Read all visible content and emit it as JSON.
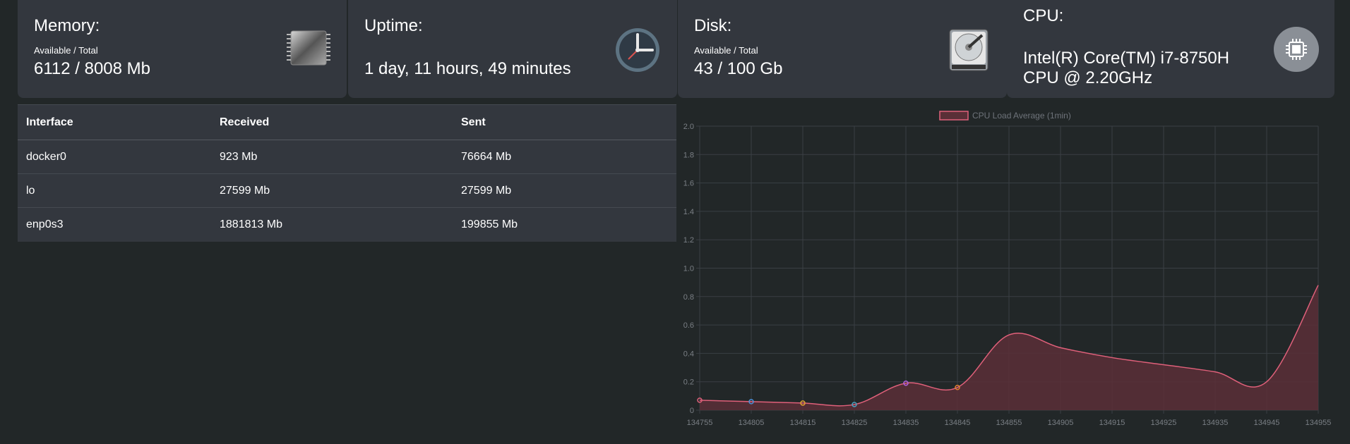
{
  "memory": {
    "title": "Memory:",
    "sub": "Available / Total",
    "value": "6112 / 8008 Mb",
    "icon": "memory-chip-icon"
  },
  "uptime": {
    "title": "Uptime:",
    "value": "1 day, 11 hours, 49 minutes",
    "icon": "clock-icon"
  },
  "disk": {
    "title": "Disk:",
    "sub": "Available / Total",
    "value": "43 / 100 Gb",
    "icon": "hard-drive-icon"
  },
  "cpu": {
    "title": "CPU:",
    "line1": "Intel(R) Core(TM) i7-8750H",
    "line2": "CPU @ 2.20GHz",
    "icon": "cpu-chip-icon"
  },
  "network": {
    "headers": [
      "Interface",
      "Received",
      "Sent"
    ],
    "rows": [
      [
        "docker0",
        "923 Mb",
        "76664 Mb"
      ],
      [
        "lo",
        "27599 Mb",
        "27599 Mb"
      ],
      [
        "enp0s3",
        "1881813 Mb",
        "199855 Mb"
      ]
    ]
  },
  "colors": {
    "background": "#222728",
    "card": "#33373e",
    "series_line": "#e0607a",
    "series_fill": "#5a2f37"
  },
  "chart_data": {
    "type": "area",
    "legend": "CPU Load Average (1min)",
    "legend_position": "top-center",
    "grid": true,
    "x": [
      "134755",
      "134805",
      "134815",
      "134825",
      "134835",
      "134845",
      "134855",
      "134905",
      "134915",
      "134925",
      "134935",
      "134945",
      "134955"
    ],
    "values": [
      0.07,
      0.06,
      0.05,
      0.04,
      0.19,
      0.16,
      0.53,
      0.44,
      0.37,
      0.32,
      0.27,
      0.2,
      0.88
    ],
    "point_markers": [
      {
        "index": 0,
        "color": "#e0607a"
      },
      {
        "index": 1,
        "color": "#4a90d9"
      },
      {
        "index": 2,
        "color": "#e0a030"
      },
      {
        "index": 3,
        "color": "#4aa0c0"
      },
      {
        "index": 4,
        "color": "#b060e0"
      },
      {
        "index": 5,
        "color": "#e08030"
      }
    ],
    "yticks": [
      "0",
      "0.2",
      "0.4",
      "0.6",
      "0.8",
      "1.0",
      "1.2",
      "1.4",
      "1.6",
      "1.8",
      "2.0"
    ],
    "ylim": [
      0,
      2
    ]
  }
}
